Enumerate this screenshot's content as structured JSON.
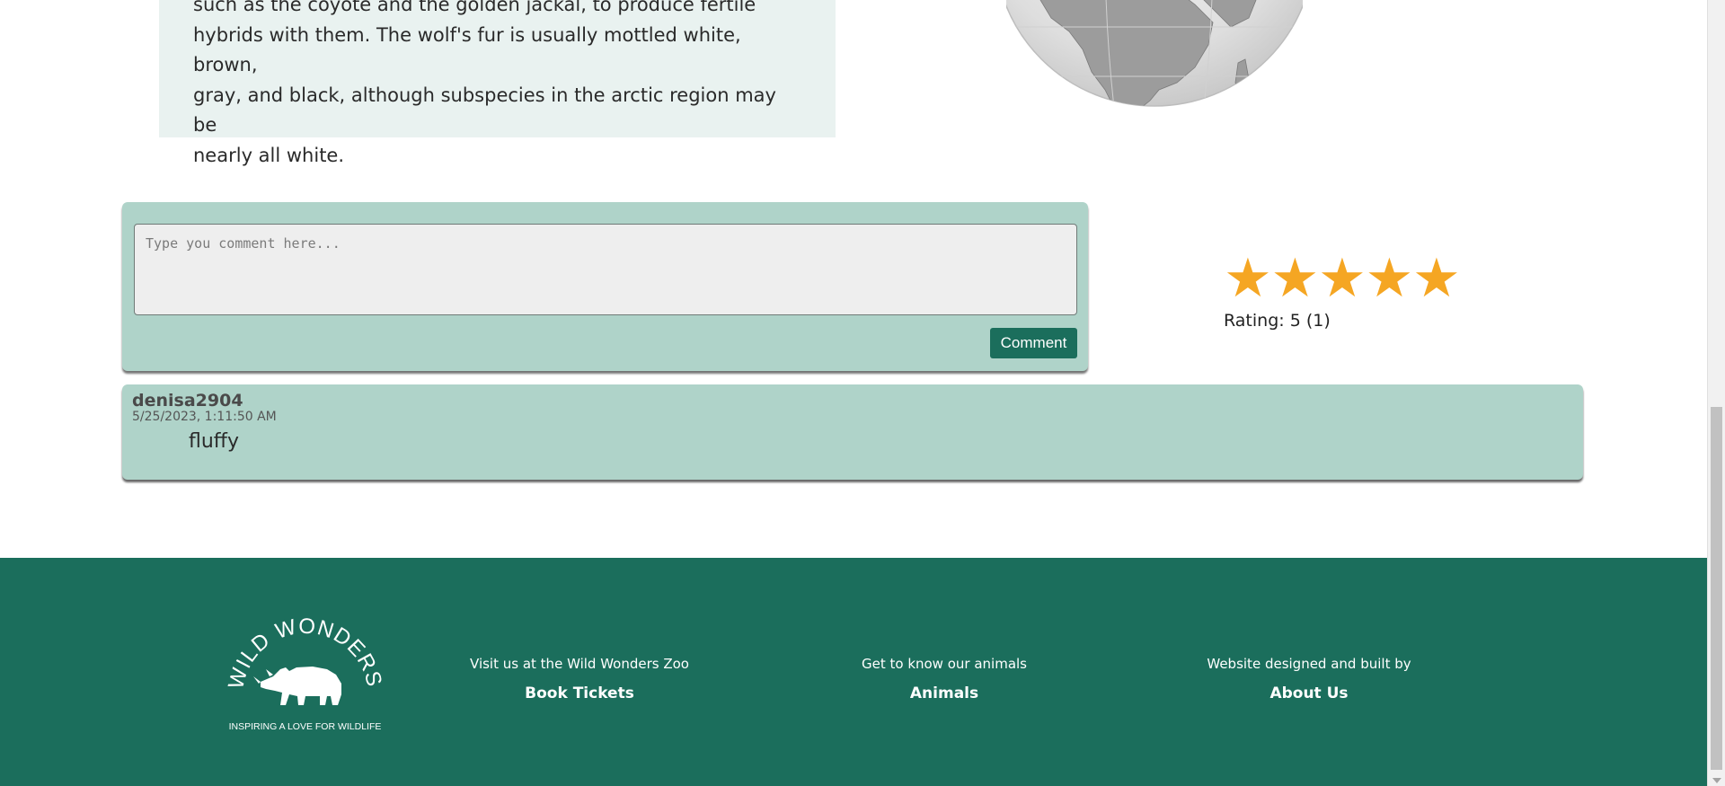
{
  "description": {
    "lines": [
      "such as the coyote and the golden jackal, to produce fertile",
      "hybrids with them. The wolf's fur is usually mottled white, brown,",
      "gray, and black, although subspecies in the arctic region may be",
      "nearly all white."
    ]
  },
  "comment_form": {
    "placeholder": "Type you comment here...",
    "button_label": "Comment"
  },
  "rating": {
    "stars": [
      "★",
      "★",
      "★",
      "★",
      "★"
    ],
    "value": 5,
    "max": 5,
    "label": "Rating: 5 (1)",
    "star_color": "#f5a623"
  },
  "comments": [
    {
      "user": "denisa2904",
      "date": "5/25/2023, 1:11:50 AM",
      "text": "fluffy"
    }
  ],
  "footer": {
    "logo": {
      "name": "WILD WONDERS ZOO",
      "tagline": "INSPIRING A LOVE FOR WILDLIFE"
    },
    "columns": [
      {
        "caption": "Visit us at the Wild Wonders Zoo",
        "link": "Book Tickets"
      },
      {
        "caption": "Get to know our animals",
        "link": "Animals"
      },
      {
        "caption": "Website designed and built by",
        "link": "About Us"
      }
    ],
    "background_color": "#1b6e5c"
  }
}
